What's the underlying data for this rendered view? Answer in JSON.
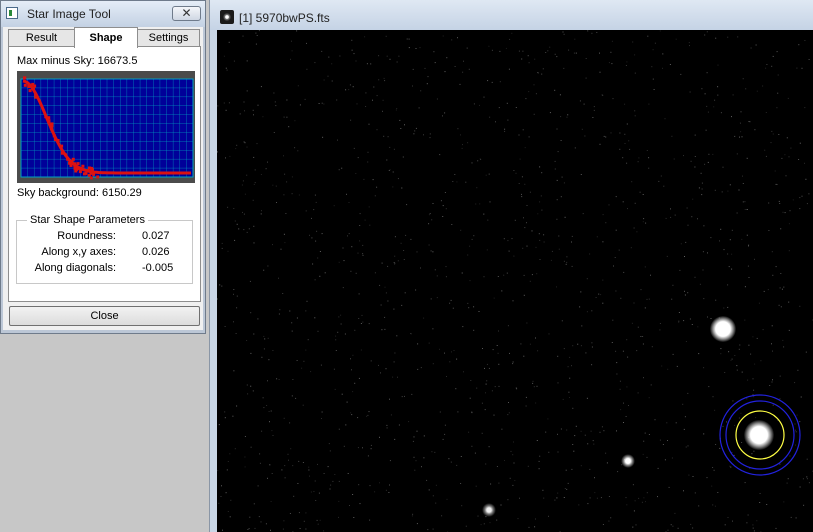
{
  "tool_window": {
    "title": "Star Image Tool",
    "close_glyph": "✕",
    "tabs": [
      {
        "label": "Result",
        "active": false
      },
      {
        "label": "Shape",
        "active": true
      },
      {
        "label": "Settings",
        "active": false
      }
    ],
    "max_minus_sky": "Max minus Sky:  16673.5",
    "sky_background": "Sky background: 6150.29",
    "shape_group_title": "Star Shape Parameters",
    "parameters": [
      {
        "label": "Roundness:",
        "value": "0.027"
      },
      {
        "label": "Along x,y axes:",
        "value": "0.026"
      },
      {
        "label": "Along diagonals:",
        "value": "-0.005"
      }
    ],
    "close_button": "Close",
    "colors": {
      "profile_line": "#dd1111",
      "plot_background": "#000099",
      "grid": "#00a0c0"
    }
  },
  "image_window": {
    "title": "[1] 5970bwPS.fts",
    "aperture_colors": {
      "inner": "#ffff44",
      "outer": "#2222dd"
    }
  }
}
